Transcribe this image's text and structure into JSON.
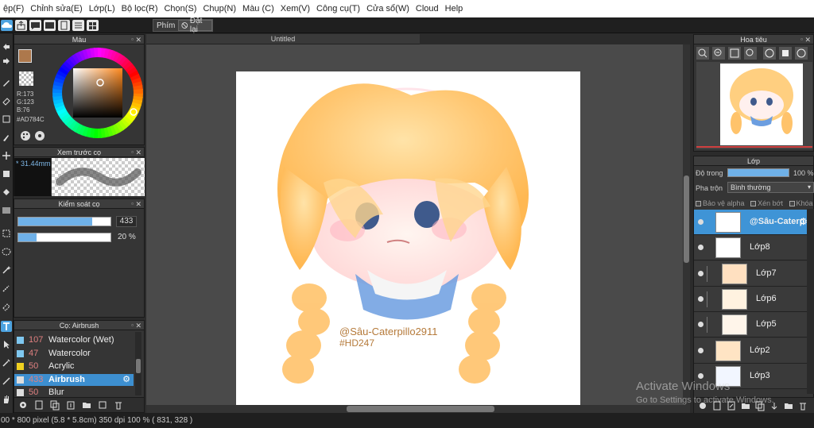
{
  "menu": [
    "ệp(F)",
    "Chỉnh sửa(E)",
    "Lớp(L)",
    "Bộ lọc(R)",
    "Chọn(S)",
    "Chụp(N)",
    "Màu (C)",
    "Xem(V)",
    "Công cụ(T)",
    "Cửa sổ(W)",
    "Cloud",
    "Help"
  ],
  "toolbar": {
    "phim_label": "Phím",
    "reset_label": "Đặt lại"
  },
  "color_panel": {
    "title": "Màu",
    "main_color": "#AD784C",
    "r": "R:173",
    "g": "G:123",
    "b": "B:76",
    "hex": "#AD784C"
  },
  "brush_preview": {
    "title": "Xem trước cọ",
    "size": "31.44mm"
  },
  "brush_control": {
    "title": "Kiểm soát cọ",
    "size_value": "433",
    "size_fraction": 0.8,
    "opacity_value": "20 %",
    "opacity_fraction": 0.2
  },
  "brush_list": {
    "title": "Cọ: Airbrush",
    "items": [
      {
        "num": "107",
        "name": "Watercolor (Wet)",
        "color": "#7fc8f0",
        "selected": false
      },
      {
        "num": "47",
        "name": "Watercolor",
        "color": "#7fc8f0",
        "selected": false
      },
      {
        "num": "50",
        "name": "Acrylic",
        "color": "#f0d020",
        "selected": false
      },
      {
        "num": "433",
        "name": "Airbrush",
        "color": "#dddddd",
        "selected": true
      },
      {
        "num": "50",
        "name": "Blur",
        "color": "#dddddd",
        "selected": false
      }
    ]
  },
  "canvas": {
    "tab_title": "Untitled",
    "watermark_name": "@Sâu-Caterpillo2911",
    "watermark_tag": "#HD247"
  },
  "navigator": {
    "title": "Hoa tiêu"
  },
  "layers_panel": {
    "title": "Lớp",
    "opacity_label": "Độ trong",
    "opacity_value": "100 %",
    "opacity_fraction": 1.0,
    "blend_label": "Pha trộn",
    "blend_value": "Bình thường",
    "alpha_label": "Bảo vệ alpha",
    "clip_label": "Xén bớt",
    "lock_label": "Khóa",
    "layers": [
      {
        "name": "@Sâu-Caterp",
        "selected": true
      },
      {
        "name": "Lớp8",
        "selected": false
      },
      {
        "name": "Lớp7",
        "selected": false
      },
      {
        "name": "Lớp6",
        "selected": false
      },
      {
        "name": "Lớp5",
        "selected": false
      },
      {
        "name": "Lớp2",
        "selected": false
      },
      {
        "name": "Lớp3",
        "selected": false
      }
    ]
  },
  "status": {
    "text": "00 * 800 pixel   (5.8 * 5.8cm)   350 dpi   100 %   ( 831, 328 )"
  },
  "windows_activation": {
    "line1": "Activate Windows",
    "line2": "Go to Settings to activate Windows."
  }
}
